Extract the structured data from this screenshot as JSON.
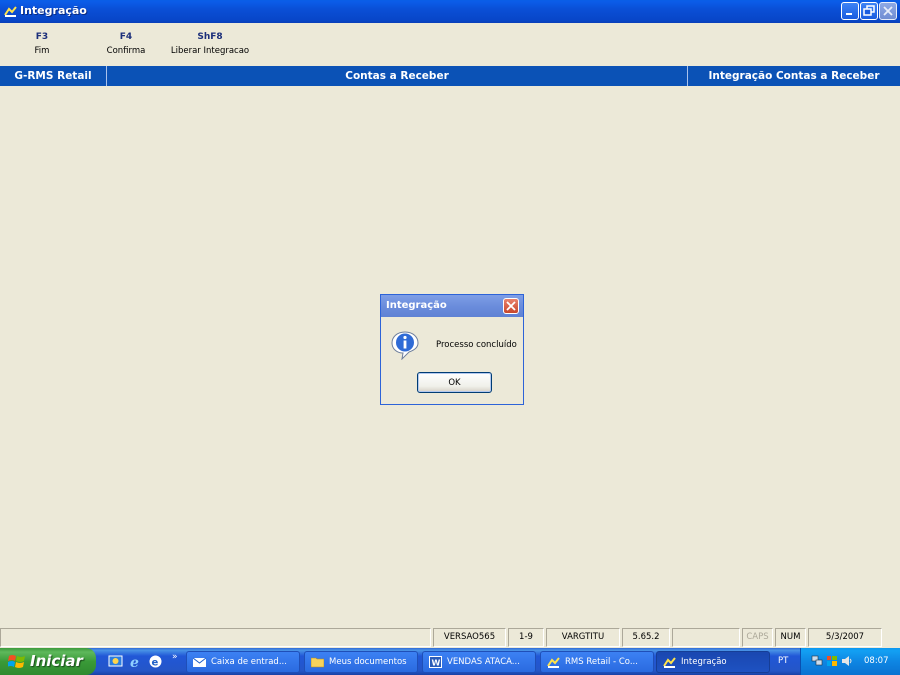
{
  "window": {
    "title": "Integração"
  },
  "function_keys": [
    {
      "key": "F3",
      "label": "Fim"
    },
    {
      "key": "F4",
      "label": "Confirma"
    },
    {
      "key": "ShF8",
      "label": "Liberar Integracao"
    }
  ],
  "header": {
    "system": "G-RMS Retail",
    "module": "Contas a Receber",
    "screen": "Integração Contas a Receber"
  },
  "dialog": {
    "title": "Integração",
    "message": "Processo concluído",
    "ok_label": "OK",
    "icon": "info-icon"
  },
  "statusbar": {
    "version": "VERSAO565",
    "page": "1-9",
    "program": "VARGTITU",
    "build": "5.65.2",
    "caps": "CAPS",
    "num": "NUM",
    "date": "5/3/2007"
  },
  "taskbar": {
    "start_label": "Iniciar",
    "quicklaunch_chevron": "»",
    "tasks": [
      {
        "label": "Caixa de entrad...",
        "icon": "outlook-icon"
      },
      {
        "label": "Meus documentos",
        "icon": "folder-icon"
      },
      {
        "label": "VENDAS ATACA...",
        "icon": "word-icon"
      },
      {
        "label": "RMS Retail - Co...",
        "icon": "rms-icon"
      },
      {
        "label": "Integração",
        "icon": "rms-icon"
      }
    ],
    "language": "PT",
    "clock": "08:07"
  },
  "colors": {
    "titlebar": "#0a4fd6",
    "header_band": "#0b52b6",
    "background": "#ece9d8",
    "taskbar": "#2456c7",
    "start_button": "#3a9a38"
  }
}
